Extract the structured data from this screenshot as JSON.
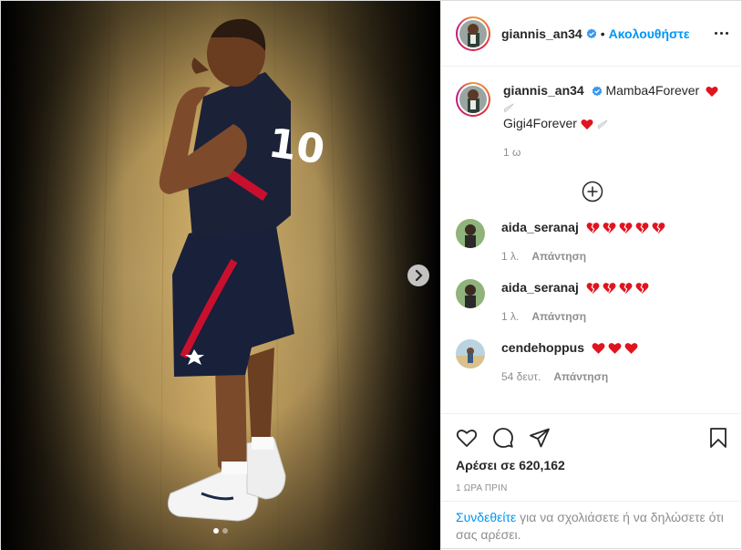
{
  "post": {
    "username": "giannis_an34",
    "separator": "•",
    "follow_label": "Ακολουθήστε",
    "more_icon": "more-options-icon",
    "carousel": {
      "slide_count": 2,
      "active_index": 0
    }
  },
  "caption": {
    "username": "giannis_an34",
    "line1": "Mamba4Forever",
    "line2": "Gigi4Forever",
    "time": "1 ω"
  },
  "load_more_icon": "plus-circle-icon",
  "comments": [
    {
      "username": "aida_seranaj",
      "hearts": 5,
      "heart_style": "broken-heart",
      "time": "1 λ.",
      "reply": "Απάντηση"
    },
    {
      "username": "aida_seranaj",
      "hearts": 4,
      "heart_style": "broken-heart",
      "time": "1 λ.",
      "reply": "Απάντηση"
    },
    {
      "username": "cendehoppus",
      "hearts": 3,
      "heart_style": "red-heart",
      "time": "54 δευτ.",
      "reply": "Απάντηση"
    }
  ],
  "actions": {
    "likes": "Αρέσει σε 620,162",
    "timestamp": "1 ΩΡΑ ΠΡΙΝ"
  },
  "login_prompt": {
    "link": "Συνδεθείτε",
    "text": " για να σχολιάσετε ή να δηλώσετε ότι σας αρέσει."
  },
  "colors": {
    "accent": "#0095f6",
    "heart": "#ed4956",
    "text": "#262626",
    "muted": "#8e8e8e"
  }
}
